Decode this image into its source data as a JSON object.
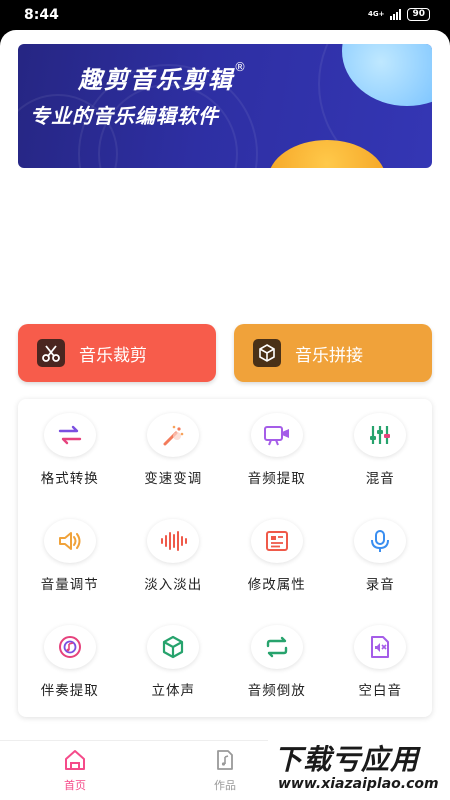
{
  "status": {
    "time": "8:44",
    "network": "4G+",
    "battery": "90"
  },
  "banner": {
    "title": "趣剪音乐剪辑",
    "reg_mark": "®",
    "subtitle": "专业的音乐编辑软件"
  },
  "main_actions": [
    {
      "label": "音乐裁剪",
      "icon": "scissors-icon",
      "color": "#f75c4b"
    },
    {
      "label": "音乐拼接",
      "icon": "cube-icon",
      "color": "#f0a23a"
    }
  ],
  "tools": [
    {
      "label": "格式转换",
      "icon": "convert-icon"
    },
    {
      "label": "变速变调",
      "icon": "magic-wand-icon"
    },
    {
      "label": "音频提取",
      "icon": "video-extract-icon"
    },
    {
      "label": "混音",
      "icon": "mixer-icon"
    },
    {
      "label": "音量调节",
      "icon": "speaker-icon"
    },
    {
      "label": "淡入淡出",
      "icon": "waveform-icon"
    },
    {
      "label": "修改属性",
      "icon": "document-icon"
    },
    {
      "label": "录音",
      "icon": "microphone-icon"
    },
    {
      "label": "伴奏提取",
      "icon": "music-disc-icon"
    },
    {
      "label": "立体声",
      "icon": "stereo-cube-icon"
    },
    {
      "label": "音频倒放",
      "icon": "reverse-icon"
    },
    {
      "label": "空白音",
      "icon": "mute-file-icon"
    }
  ],
  "tabs": [
    {
      "label": "首页",
      "icon": "home-icon",
      "active": true
    },
    {
      "label": "作品",
      "icon": "music-file-icon",
      "active": false
    }
  ],
  "watermark": {
    "main": "下载亏应用",
    "sub": "www.xiazaiplao.com"
  },
  "colors": {
    "accent": "#f54b8a",
    "cut": "#f75c4b",
    "join": "#f0a23a"
  }
}
